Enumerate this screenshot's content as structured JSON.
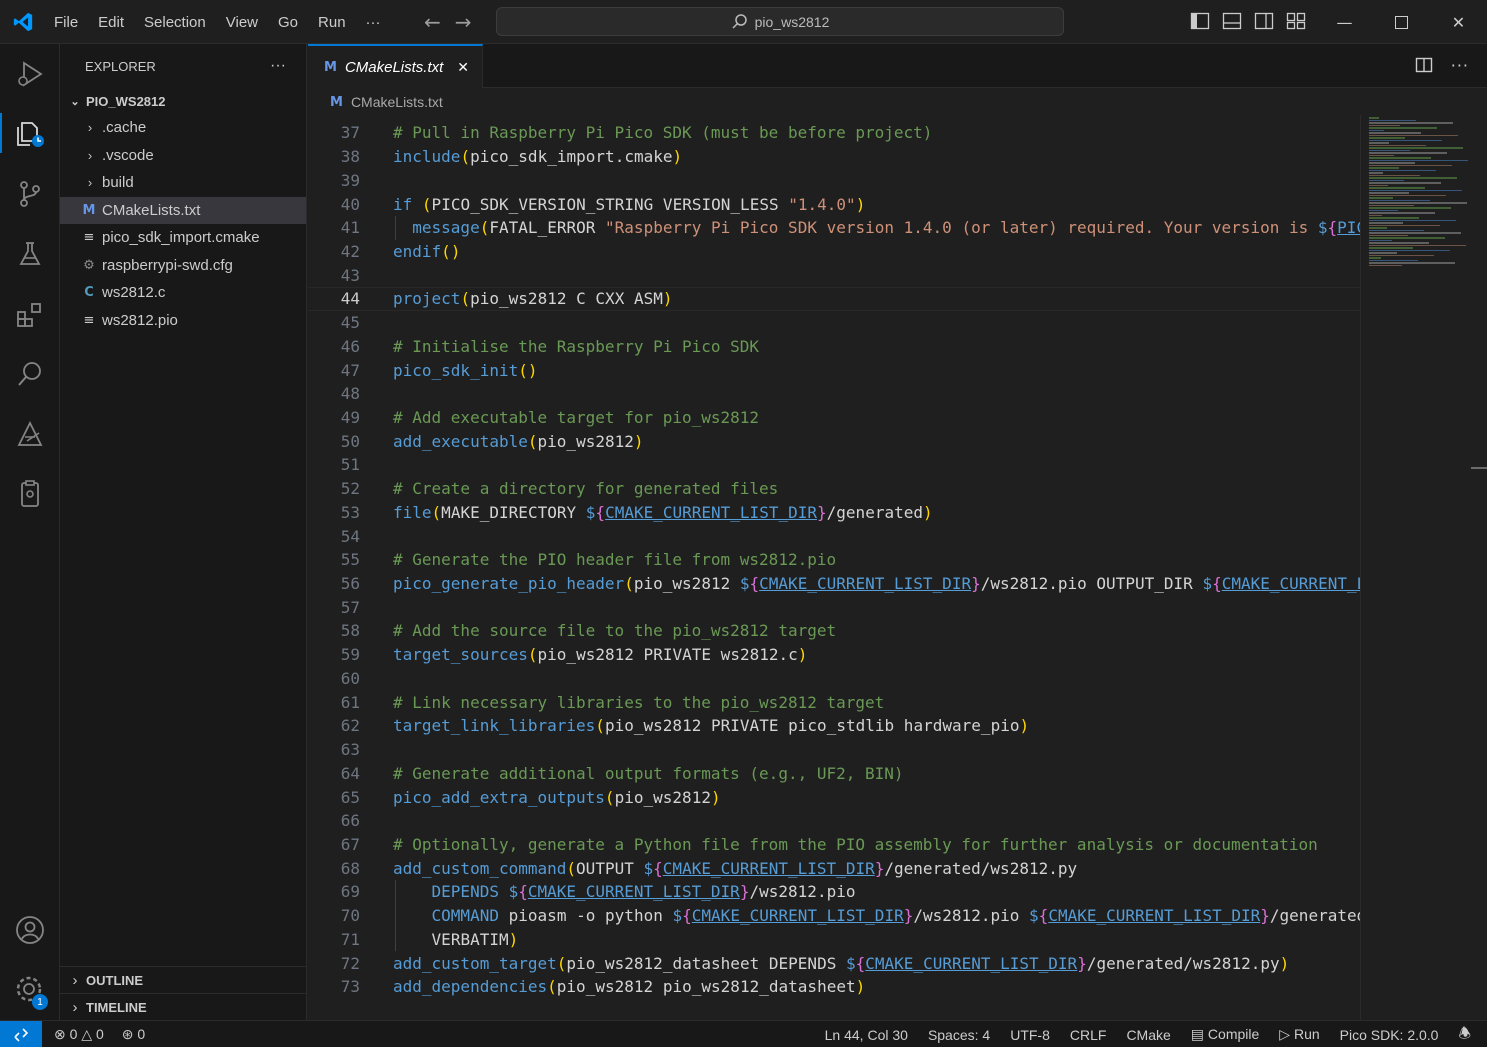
{
  "window": {
    "menu": [
      "File",
      "Edit",
      "Selection",
      "View",
      "Go",
      "Run",
      "···"
    ],
    "search_text": "pio_ws2812"
  },
  "sidebar": {
    "title": "EXPLORER",
    "more": "···",
    "folder": "PIO_WS2812",
    "items": [
      {
        "label": ".cache",
        "type": "folder"
      },
      {
        "label": ".vscode",
        "type": "folder"
      },
      {
        "label": "build",
        "type": "folder"
      },
      {
        "label": "CMakeLists.txt",
        "type": "cmake",
        "icon": "M"
      },
      {
        "label": "pico_sdk_import.cmake",
        "type": "lines"
      },
      {
        "label": "raspberrypi-swd.cfg",
        "type": "gear"
      },
      {
        "label": "ws2812.c",
        "type": "c",
        "icon": "C"
      },
      {
        "label": "ws2812.pio",
        "type": "lines"
      }
    ],
    "outline": "OUTLINE",
    "timeline": "TIMELINE"
  },
  "activity": {
    "settings_badge": "1"
  },
  "editor": {
    "tab_label": "CMakeLists.txt",
    "tab_icon": "M",
    "breadcrumb_icon": "M",
    "breadcrumb": "CMakeLists.txt",
    "lines": [
      {
        "n": "37",
        "t": "# Pull in Raspberry Pi Pico SDK (must be before project)"
      },
      {
        "n": "38",
        "t": "include(pico_sdk_import.cmake)"
      },
      {
        "n": "39",
        "t": ""
      },
      {
        "n": "40",
        "t": "if (PICO_SDK_VERSION_STRING VERSION_LESS \"1.4.0\")"
      },
      {
        "n": "41",
        "t": "  message(FATAL_ERROR \"Raspberry Pi Pico SDK version 1.4.0 (or later) required. Your version is ${PIC"
      },
      {
        "n": "42",
        "t": "endif()"
      },
      {
        "n": "43",
        "t": ""
      },
      {
        "n": "44",
        "t": "project(pio_ws2812 C CXX ASM)"
      },
      {
        "n": "45",
        "t": ""
      },
      {
        "n": "46",
        "t": "# Initialise the Raspberry Pi Pico SDK"
      },
      {
        "n": "47",
        "t": "pico_sdk_init()"
      },
      {
        "n": "48",
        "t": ""
      },
      {
        "n": "49",
        "t": "# Add executable target for pio_ws2812"
      },
      {
        "n": "50",
        "t": "add_executable(pio_ws2812)"
      },
      {
        "n": "51",
        "t": ""
      },
      {
        "n": "52",
        "t": "# Create a directory for generated files"
      },
      {
        "n": "53",
        "t": "file(MAKE_DIRECTORY ${CMAKE_CURRENT_LIST_DIR}/generated)"
      },
      {
        "n": "54",
        "t": ""
      },
      {
        "n": "55",
        "t": "# Generate the PIO header file from ws2812.pio"
      },
      {
        "n": "56",
        "t": "pico_generate_pio_header(pio_ws2812 ${CMAKE_CURRENT_LIST_DIR}/ws2812.pio OUTPUT_DIR ${CMAKE_CURRENT_L"
      },
      {
        "n": "57",
        "t": ""
      },
      {
        "n": "58",
        "t": "# Add the source file to the pio_ws2812 target"
      },
      {
        "n": "59",
        "t": "target_sources(pio_ws2812 PRIVATE ws2812.c)"
      },
      {
        "n": "60",
        "t": ""
      },
      {
        "n": "61",
        "t": "# Link necessary libraries to the pio_ws2812 target"
      },
      {
        "n": "62",
        "t": "target_link_libraries(pio_ws2812 PRIVATE pico_stdlib hardware_pio)"
      },
      {
        "n": "63",
        "t": ""
      },
      {
        "n": "64",
        "t": "# Generate additional output formats (e.g., UF2, BIN)"
      },
      {
        "n": "65",
        "t": "pico_add_extra_outputs(pio_ws2812)"
      },
      {
        "n": "66",
        "t": ""
      },
      {
        "n": "67",
        "t": "# Optionally, generate a Python file from the PIO assembly for further analysis or documentation"
      },
      {
        "n": "68",
        "t": "add_custom_command(OUTPUT ${CMAKE_CURRENT_LIST_DIR}/generated/ws2812.py"
      },
      {
        "n": "69",
        "t": "    DEPENDS ${CMAKE_CURRENT_LIST_DIR}/ws2812.pio"
      },
      {
        "n": "70",
        "t": "    COMMAND pioasm -o python ${CMAKE_CURRENT_LIST_DIR}/ws2812.pio ${CMAKE_CURRENT_LIST_DIR}/generated"
      },
      {
        "n": "71",
        "t": "    VERBATIM)"
      },
      {
        "n": "72",
        "t": "add_custom_target(pio_ws2812_datasheet DEPENDS ${CMAKE_CURRENT_LIST_DIR}/generated/ws2812.py)"
      },
      {
        "n": "73",
        "t": "add_dependencies(pio_ws2812 pio_ws2812_datasheet)"
      }
    ],
    "current_line": "44"
  },
  "statusbar": {
    "errors": "0",
    "warnings": "0",
    "ports": "0",
    "position": "Ln 44, Col 30",
    "spaces": "Spaces: 4",
    "encoding": "UTF-8",
    "eol": "CRLF",
    "language": "CMake",
    "compile": "Compile",
    "run": "Run",
    "sdk": "Pico SDK: 2.0.0"
  },
  "colors": {
    "accent": "#0078d4",
    "comment": "#6a9955",
    "keyword": "#569cd6",
    "string": "#ce9178",
    "cmake_icon": "#6796e6",
    "c_icon": "#519aba"
  }
}
